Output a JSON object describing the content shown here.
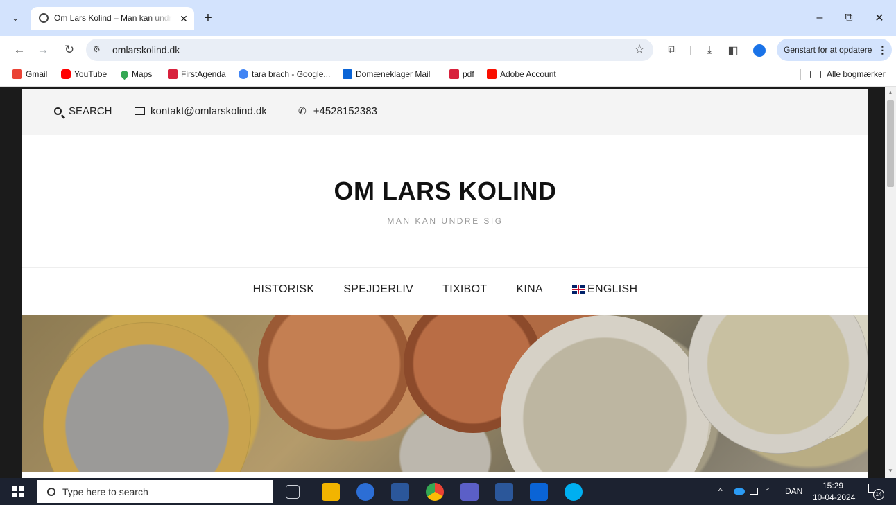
{
  "browser": {
    "tab_title": "Om Lars Kolind – Man kan undre sig",
    "tab_close": "✕",
    "new_tab": "+",
    "url": "omlarskolind.dk",
    "update_label": "Genstart for at opdatere",
    "window": {
      "minimize": "–",
      "restore": "⧉",
      "close": "✕"
    },
    "bookmarks": [
      {
        "label": "Gmail",
        "color": "#ea4335"
      },
      {
        "label": "YouTube",
        "color": "#ff0000"
      },
      {
        "label": "Maps",
        "color": "#34a853"
      },
      {
        "label": "FirstAgenda",
        "color": "#d8213c"
      },
      {
        "label": "tara brach - Google...",
        "color": "#4285f4"
      },
      {
        "label": "Domæneklager Mail",
        "color": "#0a64d6"
      },
      {
        "label": "pdf",
        "color": "#d8213c"
      },
      {
        "label": "Adobe Account",
        "color": "#fa0f00"
      }
    ],
    "all_bookmarks": "Alle bogmærker"
  },
  "site": {
    "search_label": "SEARCH",
    "email": "kontakt@omlarskolind.dk",
    "phone": "+4528152383",
    "title": "OM LARS KOLIND",
    "tagline": "MAN KAN UNDRE SIG",
    "nav": [
      "HISTORISK",
      "SPEJDERLIV",
      "TIXIBOT",
      "KINA",
      "ENGLISH"
    ]
  },
  "taskbar": {
    "search_placeholder": "Type here to search",
    "language": "DAN",
    "time": "15:29",
    "date": "10-04-2024",
    "notifications": "14"
  }
}
